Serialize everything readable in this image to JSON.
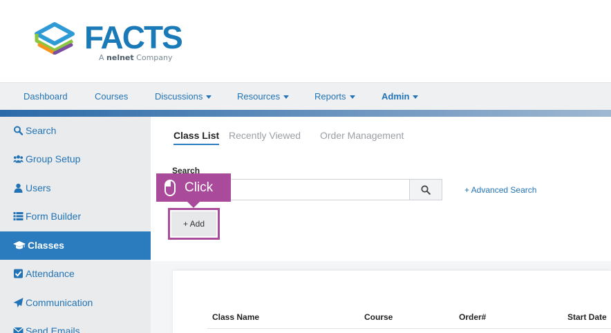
{
  "logo": {
    "word": "FACTS",
    "sub_prefix": "A",
    "sub_brand": "nelnet",
    "sub_suffix": "Company",
    "colors": [
      "#2f9bd6",
      "#8cc63f",
      "#f7941d",
      "#7b4fa0",
      "#1a7ab8"
    ]
  },
  "nav": {
    "items": [
      {
        "label": "Dashboard",
        "dropdown": false
      },
      {
        "label": "Courses",
        "dropdown": false
      },
      {
        "label": "Discussions",
        "dropdown": true
      },
      {
        "label": "Resources",
        "dropdown": true
      },
      {
        "label": "Reports",
        "dropdown": true
      },
      {
        "label": "Admin",
        "dropdown": true
      }
    ]
  },
  "sidebar": {
    "items": [
      {
        "label": "Search",
        "icon": "search-icon"
      },
      {
        "label": "Group Setup",
        "icon": "group-icon"
      },
      {
        "label": "Users",
        "icon": "user-icon"
      },
      {
        "label": "Form Builder",
        "icon": "list-icon"
      },
      {
        "label": "Classes",
        "icon": "graduation-cap-icon",
        "active": true
      },
      {
        "label": "Attendance",
        "icon": "checkbox-icon"
      },
      {
        "label": "Communication",
        "icon": "paper-plane-icon"
      },
      {
        "label": "Send Emails",
        "icon": "envelope-icon"
      }
    ]
  },
  "tabs": [
    {
      "label": "Class List",
      "active": true
    },
    {
      "label": "Recently Viewed",
      "active": false
    },
    {
      "label": "Order Management",
      "active": false
    }
  ],
  "search": {
    "label": "Search",
    "value": "",
    "advanced_link": "+ Advanced Search"
  },
  "add_button": {
    "label": "+ Add"
  },
  "callout": {
    "text": "Click",
    "icon": "mouse-icon",
    "color": "#a94a9a"
  },
  "table": {
    "headers": [
      "Class Name",
      "Course",
      "Order#",
      "Start Date"
    ]
  },
  "colors": {
    "link": "#2273b5",
    "active_sidebar": "#2b7bbf",
    "highlight": "#a94a9a"
  }
}
